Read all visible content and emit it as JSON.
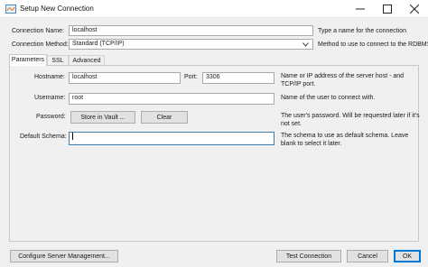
{
  "window": {
    "title": "Setup New Connection"
  },
  "connection_name": {
    "label": "Connection Name:",
    "value": "localhost",
    "hint": "Type a name for the connection"
  },
  "connection_method": {
    "label": "Connection Method:",
    "value": "Standard (TCP/IP)",
    "hint": "Method to use to connect to the RDBMS"
  },
  "tabs": [
    {
      "label": "Parameters",
      "active": true
    },
    {
      "label": "SSL",
      "active": false
    },
    {
      "label": "Advanced",
      "active": false
    }
  ],
  "hostname": {
    "label": "Hostname:",
    "value": "localhost",
    "hint_line1": "Name or IP address of the server host - and",
    "hint_line2": "TCP/IP port."
  },
  "port": {
    "label": "Port:",
    "value": "3306"
  },
  "username": {
    "label": "Username:",
    "value": "root",
    "hint": "Name of the user to connect with."
  },
  "password": {
    "label": "Password:",
    "store_button": "Store in Vault ...",
    "clear_button": "Clear",
    "hint_line1": "The user's password. Will be requested later if it's",
    "hint_line2": "not set."
  },
  "default_schema": {
    "label": "Default Schema:",
    "value": "",
    "hint_line1": "The schema to use as default schema. Leave",
    "hint_line2": "blank to select it later."
  },
  "footer": {
    "configure_button": "Configure Server Management...",
    "test_button": "Test Connection",
    "cancel_button": "Cancel",
    "ok_button": "OK"
  },
  "colors": {
    "focus_border": "#3c7fb1",
    "default_button_border": "#0078d7",
    "window_bg": "#f0f0f0"
  },
  "icons": {
    "app": "mysql-workbench-app-icon",
    "minimize": "minimize-icon",
    "maximize": "maximize-icon",
    "close": "close-icon",
    "dropdown": "chevron-down-icon"
  }
}
